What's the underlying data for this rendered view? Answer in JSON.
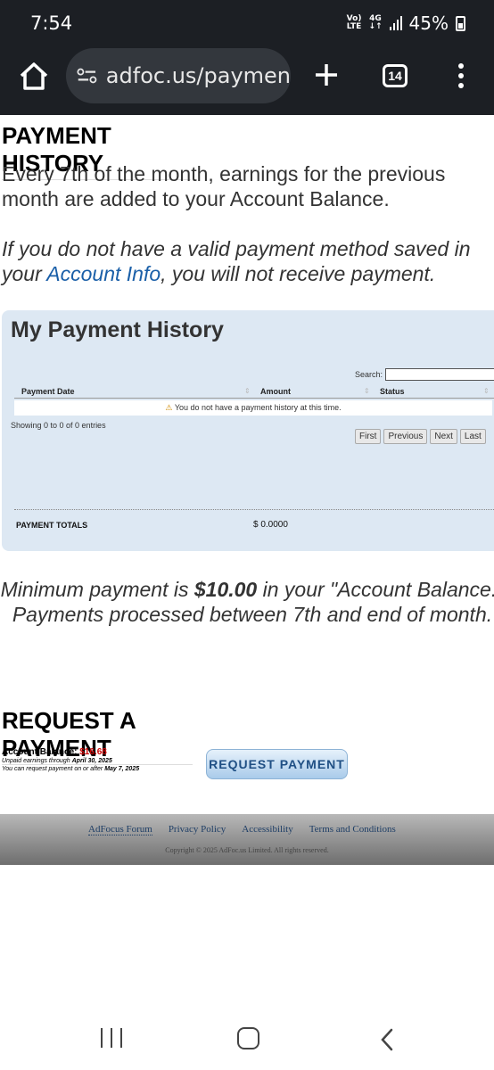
{
  "status_bar": {
    "time": "7:54",
    "net_top": "Vo)",
    "net_bottom": "LTE",
    "gen_top": "4G",
    "gen_bottom": "↓↑",
    "battery": "45%"
  },
  "browser": {
    "url": "adfoc.us/paymen",
    "tab_count": "14"
  },
  "page": {
    "payment_history_heading": "PAYMENT HISTORY",
    "intro": "Every 7th of the month, earnings for the previous month are added to your Account Balance.",
    "notice_line1": "If you do not have a valid payment method saved in",
    "notice_prefix": "your ",
    "notice_link": "Account Info",
    "notice_suffix": ", you will not receive payment.",
    "panel": {
      "title": "My Payment History",
      "search_label": "Search:",
      "columns": [
        "Payment Date",
        "Amount",
        "Status"
      ],
      "empty_message": "You do not have a payment history at this time.",
      "showing": "Showing 0 to 0 of 0 entries",
      "pager": [
        "First",
        "Previous",
        "Next",
        "Last"
      ],
      "totals_label": "PAYMENT TOTALS",
      "totals_value": "$ 0.0000"
    },
    "min_payment_prefix": "Minimum payment is ",
    "min_payment_amount": "$10.00",
    "min_payment_suffix": " in your \"Account Balance.\" Payments processed between 7th and end of month.",
    "request_heading": "REQUEST A PAYMENT",
    "account_balance_label": "Account Balance:",
    "account_balance_value": "$16.68",
    "unpaid_prefix": "Unpaid earnings through ",
    "unpaid_date": "April 30, 2025",
    "request_after_prefix": "You can request payment on or after ",
    "request_after_date": "May 7, 2025",
    "request_button": "REQUEST PAYMENT"
  },
  "footer": {
    "links": [
      "AdFocus Forum",
      "Privacy Policy",
      "Accessibility",
      "Terms and Conditions"
    ],
    "copyright": "Copyright © 2025 AdFoc.us Limited. All rights reserved."
  },
  "colors": {
    "link": "#1a5fa8",
    "balance": "#cc0000",
    "panel_bg": "#dde8f3"
  }
}
